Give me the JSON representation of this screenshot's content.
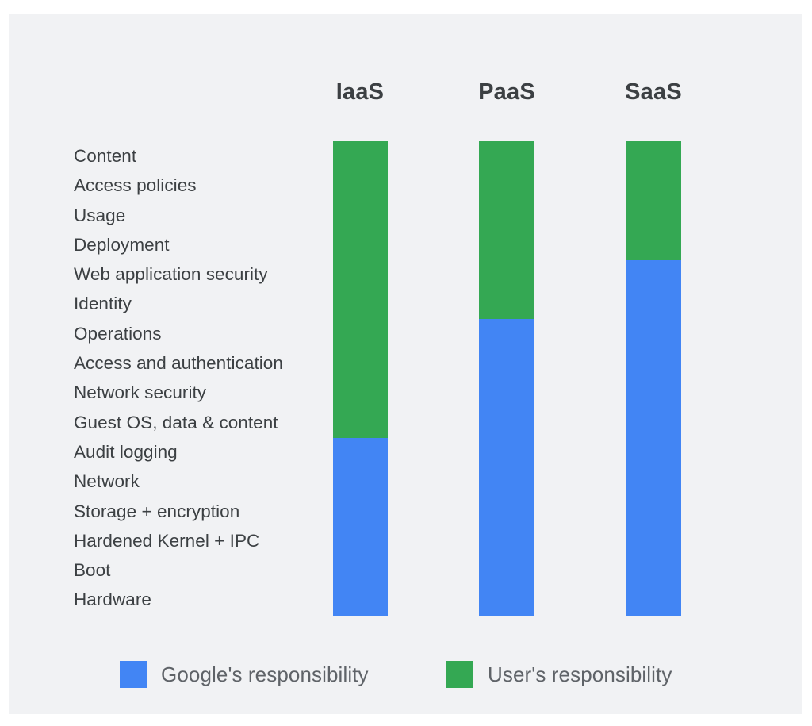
{
  "figure": {
    "background_color": "#ffffff",
    "panel_color": "#f1f2f4",
    "text_color": "#3c4043",
    "legend_text_color": "#5f6368"
  },
  "columns": [
    {
      "label": "IaaS"
    },
    {
      "label": "PaaS"
    },
    {
      "label": "SaaS"
    }
  ],
  "rows": [
    {
      "label": "Content"
    },
    {
      "label": "Access policies"
    },
    {
      "label": "Usage"
    },
    {
      "label": "Deployment"
    },
    {
      "label": "Web application security"
    },
    {
      "label": "Identity"
    },
    {
      "label": "Operations"
    },
    {
      "label": "Access and authentication"
    },
    {
      "label": "Network security"
    },
    {
      "label": "Guest OS, data & content"
    },
    {
      "label": "Audit logging"
    },
    {
      "label": "Network"
    },
    {
      "label": "Storage + encryption"
    },
    {
      "label": "Hardened Kernel + IPC"
    },
    {
      "label": "Boot"
    },
    {
      "label": "Hardware"
    }
  ],
  "legend": [
    {
      "label": "Google's responsibility",
      "color": "#4285f4",
      "key": "google"
    },
    {
      "label": "User's responsibility",
      "color": "#34a853",
      "key": "user"
    }
  ],
  "chart_data": {
    "type": "bar",
    "title": "",
    "subtitle": "",
    "xlabel": "",
    "ylabel": "",
    "orientation": "vertical",
    "stacked": true,
    "grid": false,
    "legend_position": "bottom",
    "categories": [
      "IaaS",
      "PaaS",
      "SaaS"
    ],
    "row_categories": [
      "Content",
      "Access policies",
      "Usage",
      "Deployment",
      "Web application security",
      "Identity",
      "Operations",
      "Access and authentication",
      "Network security",
      "Guest OS, data & content",
      "Audit logging",
      "Network",
      "Storage + encryption",
      "Hardened Kernel + IPC",
      "Boot",
      "Hardware"
    ],
    "series": [
      {
        "name": "User's responsibility",
        "color": "#34a853",
        "values": [
          10,
          6,
          4
        ],
        "units": "rows"
      },
      {
        "name": "Google's responsibility",
        "color": "#4285f4",
        "values": [
          6,
          10,
          12
        ],
        "units": "rows"
      }
    ],
    "ylim": [
      0,
      16
    ],
    "notes": "Stacked bars of 16 responsibility rows; green = user-owned rows counted from the top, blue = Google-owned rows counted from the bottom."
  }
}
